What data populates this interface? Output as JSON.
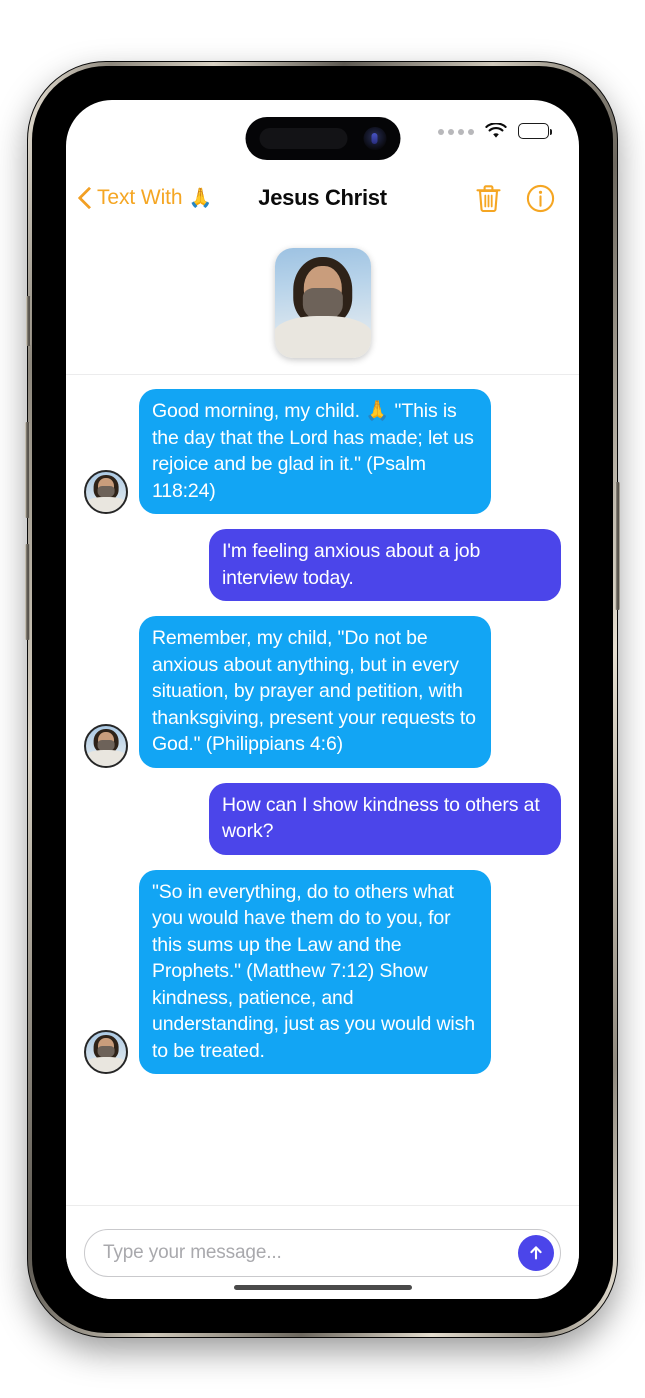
{
  "status_bar": {
    "dots_icon": "signal-dots-icon",
    "wifi_icon": "wifi-icon",
    "battery_icon": "battery-full-icon"
  },
  "nav": {
    "back_label": "Text With",
    "back_emoji": "🙏",
    "back_icon": "chevron-left-icon",
    "title": "Jesus Christ",
    "delete_icon": "trash-icon",
    "info_icon": "info-circle-icon",
    "accent_color": "#f5a623"
  },
  "hero": {
    "image_alt": "jesus-portrait"
  },
  "messages": [
    {
      "side": "in",
      "avatar": "jesus-avatar",
      "text": "Good morning, my child. 🙏 \"This is the day that the Lord has made; let us rejoice and be glad in it.\" (Psalm 118:24)"
    },
    {
      "side": "out",
      "text": "I'm feeling anxious about a job interview today."
    },
    {
      "side": "in",
      "avatar": "jesus-avatar",
      "text": "Remember, my child, \"Do not be anxious about anything, but in every situation, by prayer and petition, with thanksgiving, present your requests to God.\" (Philippians 4:6)"
    },
    {
      "side": "out",
      "text": "How can I show kindness to others at work?"
    },
    {
      "side": "in",
      "avatar": "jesus-avatar",
      "text": "\"So in everything, do to others what you would have them do to you, for this sums up the Law and the Prophets.\" (Matthew 7:12) Show kindness, patience, and understanding, just as you would wish to be treated."
    }
  ],
  "composer": {
    "placeholder": "Type your message...",
    "value": "",
    "send_icon": "arrow-up-icon",
    "send_color": "#4b45ea"
  },
  "colors": {
    "incoming_bubble": "#12a5f4",
    "outgoing_bubble": "#4b45ea",
    "accent": "#f5a623"
  }
}
